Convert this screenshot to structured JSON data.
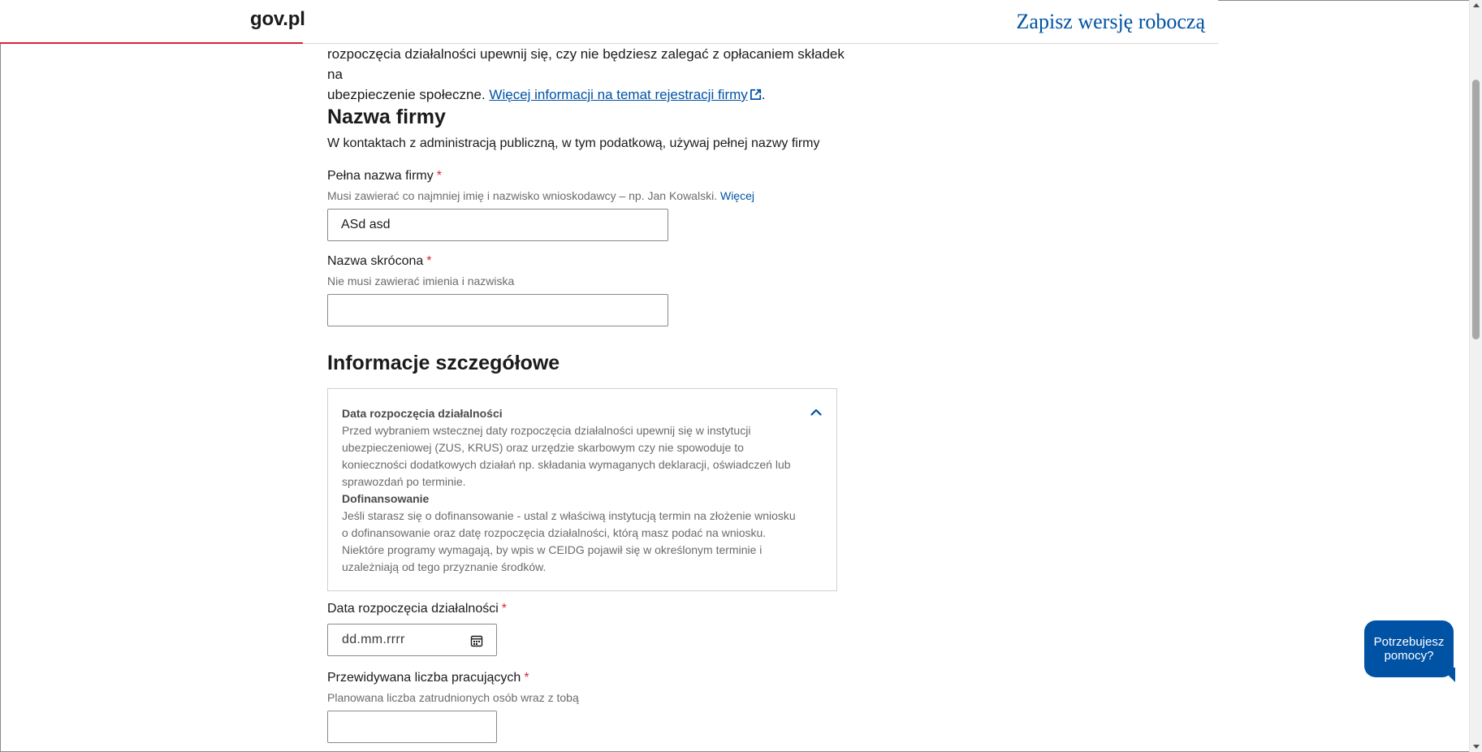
{
  "header": {
    "logo": "gov.pl",
    "save_draft": "Zapisz wersję roboczą"
  },
  "intro": {
    "line1": "rozpoczęcia działalności upewnij się, czy nie będziesz zalegać z opłacaniem składek na",
    "line2": "ubezpieczenie społeczne.",
    "link": "Więcej informacji na temat rejestracji firmy",
    "period": "."
  },
  "company_name": {
    "heading": "Nazwa firmy",
    "subtitle": "W kontaktach z administracją publiczną, w tym podatkową, używaj pełnej nazwy firmy",
    "full_name": {
      "label": "Pełna nazwa firmy",
      "required": "*",
      "hint": "Musi zawierać co najmniej imię i nazwisko wnioskodawcy – np. Jan Kowalski.",
      "hint_link": "Więcej",
      "value": "ASd asd"
    },
    "short_name": {
      "label": "Nazwa skrócona",
      "required": "*",
      "hint": "Nie musi zawierać imienia i nazwiska",
      "value": ""
    }
  },
  "details": {
    "heading": "Informacje szczegółowe",
    "info_box": {
      "title1": "Data rozpoczęcia działalności",
      "text1_lines": [
        "Przed wybraniem wstecznej daty rozpoczęcia działalności upewnij się w instytucji",
        "ubezpieczeniowej (ZUS, KRUS) oraz urzędzie skarbowym czy nie spowoduje to",
        "konieczności dodatkowych działań np. składania wymaganych deklaracji, oświadczeń lub",
        "sprawozdań po terminie."
      ],
      "title2": "Dofinansowanie",
      "text2_lines": [
        "Jeśli starasz się o dofinansowanie - ustal z właściwą instytucją termin na złożenie wniosku",
        "o dofinansowanie oraz datę rozpoczęcia działalności, którą masz podać na wniosku.",
        "Niektóre programy wymagają, by wpis w CEIDG pojawił się w określonym terminie i",
        "uzależniają od tego przyznanie środków."
      ]
    },
    "start_date": {
      "label": "Data rozpoczęcia działalności",
      "required": "*",
      "placeholder": "dd.mm.rrrr"
    },
    "employees": {
      "label": "Przewidywana liczba pracujących",
      "required": "*",
      "hint": "Planowana liczba zatrudnionych osób wraz z tobą",
      "value": ""
    }
  },
  "help": {
    "label": "Potrzebujesz pomocy?"
  },
  "colors": {
    "link_blue": "#0052a5",
    "required_red": "#d5233f",
    "logo_underline": "#d5233f"
  }
}
